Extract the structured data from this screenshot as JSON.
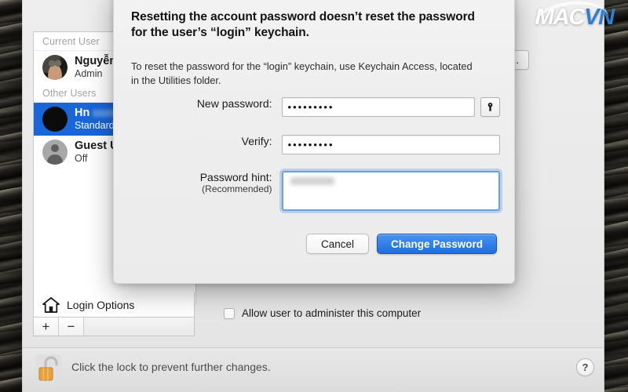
{
  "watermark": {
    "primary": "MAC",
    "secondary": "VN"
  },
  "prefs_window": {
    "user_list": {
      "groups": [
        {
          "header": "Current User",
          "users": [
            {
              "name": "Nguyễn T",
              "role": "Admin",
              "avatar": "user-photo-avatar",
              "selected": false,
              "redacted": false
            }
          ]
        },
        {
          "header": "Other Users",
          "users": [
            {
              "name": "Hn",
              "role": "Standard",
              "avatar": "blank-avatar",
              "selected": true,
              "redacted": true
            },
            {
              "name": "Guest U",
              "role": "Off",
              "avatar": "guest-silhouette-avatar",
              "selected": false,
              "redacted": false
            }
          ]
        }
      ]
    },
    "login_options": {
      "label": "Login Options",
      "icon": "house-icon"
    },
    "list_toolbar": {
      "add_label": "+",
      "remove_label": "−"
    },
    "right_pane": {
      "reset_password_button": "ssword...",
      "administer_checkbox": {
        "label": "Allow user to administer this computer",
        "checked": false
      }
    },
    "bottom_bar": {
      "lock_icon": "open-padlock-icon",
      "lock_text": "Click the lock to prevent further changes.",
      "help_label": "?"
    }
  },
  "sheet": {
    "title": "Resetting the account password doesn’t reset the password for the user’s “login” keychain.",
    "subtitle": "To reset the password for the “login” keychain, use Keychain Access, located in the Utilities folder.",
    "fields": {
      "new_password": {
        "label": "New password:",
        "value": "•••••••••",
        "placeholder": ""
      },
      "verify": {
        "label": "Verify:",
        "value": "•••••••••",
        "placeholder": ""
      },
      "password_hint": {
        "label": "Password hint:",
        "sublabel": "(Recommended)",
        "value": "",
        "placeholder": "",
        "focused": true
      }
    },
    "key_button_icon": "key-icon",
    "buttons": {
      "cancel": "Cancel",
      "confirm": "Change Password"
    },
    "accent_color": "#1c6fdd",
    "focus_ring_color": "#6a9fe0"
  }
}
